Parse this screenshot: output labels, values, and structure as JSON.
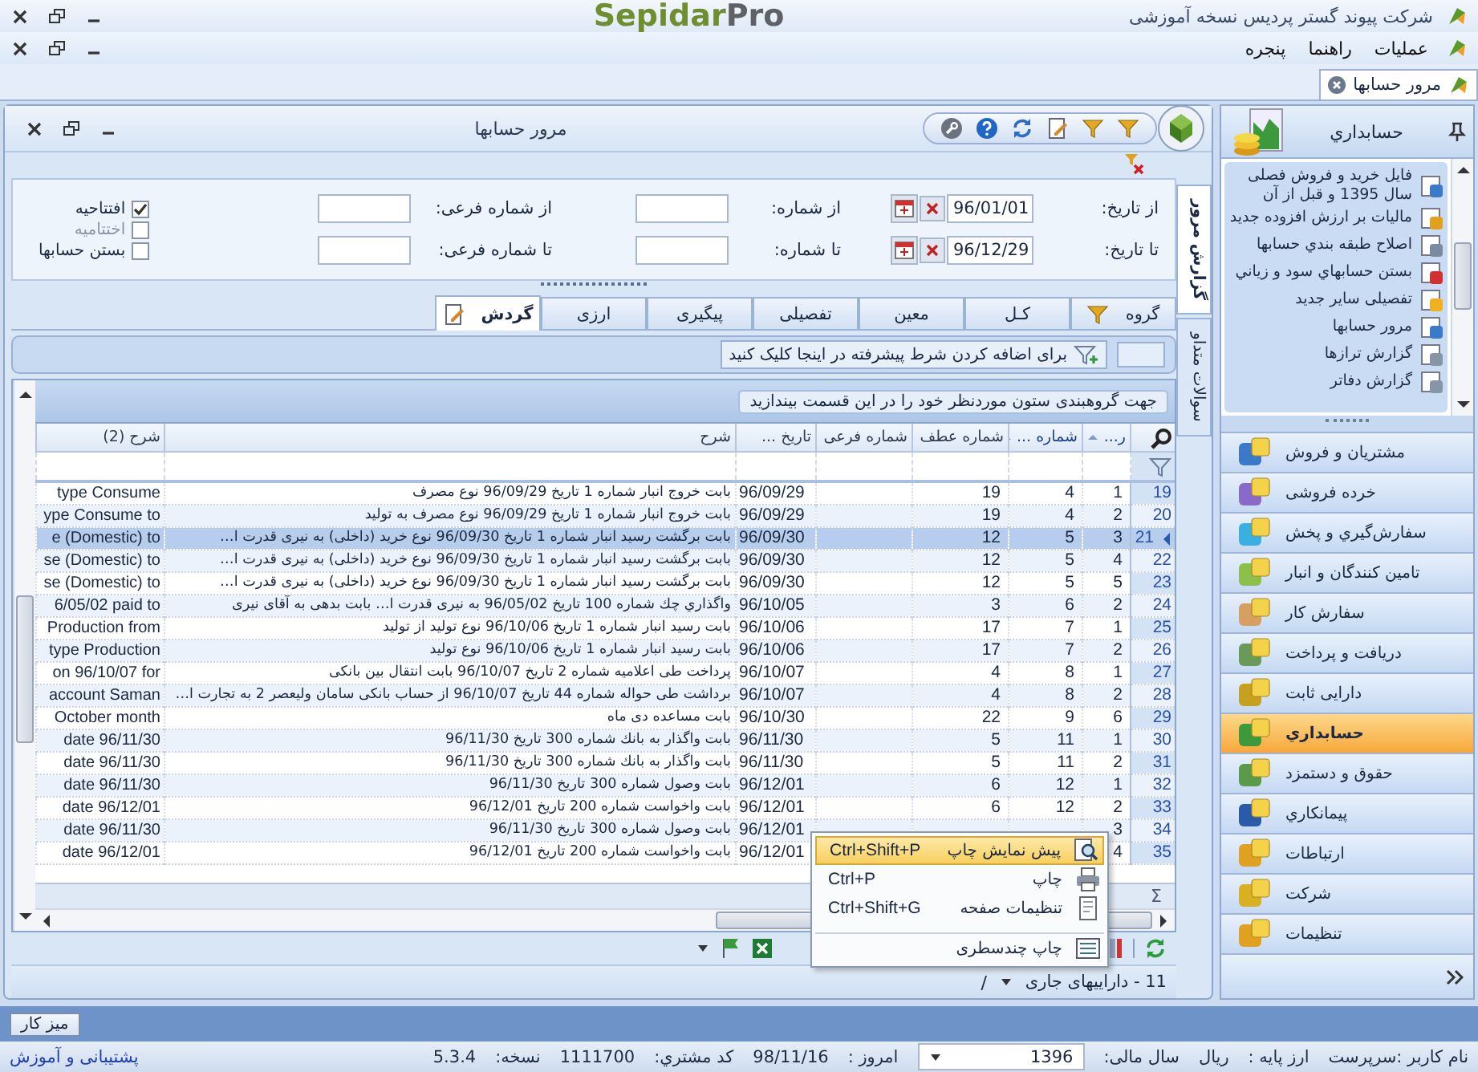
{
  "app_title": "شرکت پیوند گستر پردیس نسخه آموزشی",
  "logo": {
    "primary": "Sepidar",
    "secondary": "Pro"
  },
  "menu": [
    "عملیات",
    "راهنما",
    "پنجره"
  ],
  "document_tabs": [
    {
      "label": "مرور حسابها",
      "selected": true
    }
  ],
  "window": {
    "title": "مرور حسابها"
  },
  "side_tabs": [
    {
      "label": "گزارش مرور",
      "selected": true
    },
    {
      "label": "سوالات متداو",
      "selected": false
    }
  ],
  "filter_rows": [
    [
      {
        "kind": "date",
        "label": "از تاریخ:",
        "value": "96/01/01"
      },
      {
        "kind": "text",
        "label": "از شماره:"
      },
      {
        "kind": "text",
        "label": "از شماره فرعی:"
      }
    ],
    [
      {
        "kind": "date",
        "label": "تا تاریخ:",
        "value": "96/12/29"
      },
      {
        "kind": "text",
        "label": "تا شماره:"
      },
      {
        "kind": "text",
        "label": "تا شماره فرعی:"
      }
    ]
  ],
  "options": [
    {
      "label": "افتتاحیه",
      "checked": true,
      "disabled": false
    },
    {
      "label": "اختتامیه",
      "checked": false,
      "disabled": true
    },
    {
      "label": "بستن حسابها",
      "checked": false,
      "disabled": false
    }
  ],
  "report_tabs": [
    {
      "label": "گروه",
      "selected": false,
      "has_icon": true
    },
    {
      "label": "کـل",
      "selected": false,
      "has_icon": false
    },
    {
      "label": "معین",
      "selected": false,
      "has_icon": false
    },
    {
      "label": "تفصیلی",
      "selected": false,
      "has_icon": false
    },
    {
      "label": "پیگیری",
      "selected": false,
      "has_icon": false
    },
    {
      "label": "ارزی",
      "selected": false,
      "has_icon": false
    },
    {
      "label": "گردش",
      "selected": true,
      "has_icon": true
    }
  ],
  "advanced_filter": {
    "button": "برای اضافه کردن شرط پیشرفته در اینجا کلیک کنید"
  },
  "grid": {
    "group_hint": "جهت گروهبندی ستون موردنظر خود را در این قسمت بیندازید",
    "columns": [
      {
        "label": "ر...",
        "sorted": true
      },
      {
        "label": "شماره ...",
        "sorted": true
      },
      {
        "label": "شماره عطف",
        "sorted": false
      },
      {
        "label": "شماره فرعی",
        "sorted": false
      },
      {
        "label": "تاریخ ...",
        "sorted": false
      },
      {
        "label": "شرح",
        "sorted": false
      },
      {
        "label": "شرح (2)",
        "sorted": false
      }
    ],
    "rows": [
      {
        "row_number": "19",
        "index": "1",
        "number": "4",
        "reference": "19",
        "date": "96/09/29",
        "description": "بابت خروج انبار شماره 1 تاریخ 96/09/29 نوع مصرف",
        "description_2": "type Consume",
        "selected": false
      },
      {
        "row_number": "20",
        "index": "2",
        "number": "4",
        "reference": "19",
        "date": "96/09/29",
        "description": "بابت خروج انبار شماره 1 تاریخ 96/09/29 نوع مصرف به تولید",
        "description_2": "ype Consume to",
        "selected": false
      },
      {
        "row_number": "21",
        "index": "3",
        "number": "5",
        "reference": "12",
        "date": "96/09/30",
        "description": "بابت برگشت رسید انبار شماره 1 تاریخ 96/09/30 نوع خرید (داخلی) به نیری قدرت ا…",
        "description_2": "e (Domestic) to",
        "selected": true
      },
      {
        "row_number": "22",
        "index": "4",
        "number": "5",
        "reference": "12",
        "date": "96/09/30",
        "description": "بابت برگشت رسید انبار شماره 1 تاریخ 96/09/30 نوع خرید (داخلی) به نیری قدرت ا…",
        "description_2": "se (Domestic) to",
        "selected": false
      },
      {
        "row_number": "23",
        "index": "5",
        "number": "5",
        "reference": "12",
        "date": "96/09/30",
        "description": "بابت برگشت رسید انبار شماره 1 تاریخ 96/09/30 نوع خرید (داخلی) به نیری قدرت ا…",
        "description_2": "se (Domestic) to",
        "selected": false
      },
      {
        "row_number": "24",
        "index": "2",
        "number": "6",
        "reference": "3",
        "date": "96/10/05",
        "description": "واگذاري چك شماره 100 تاریخ 96/05/02 به نیری قدرت ا…  بابت بدهی به آقای نیری",
        "description_2": "6/05/02 paid to",
        "selected": false
      },
      {
        "row_number": "25",
        "index": "1",
        "number": "7",
        "reference": "17",
        "date": "96/10/06",
        "description": "بابت رسید انبار شماره 1 تاریخ 96/10/06 نوع تولید از تولید",
        "description_2": "Production from",
        "selected": false
      },
      {
        "row_number": "26",
        "index": "2",
        "number": "7",
        "reference": "17",
        "date": "96/10/06",
        "description": "بابت رسید انبار شماره 1 تاریخ 96/10/06 نوع تولید",
        "description_2": "type Production",
        "selected": false
      },
      {
        "row_number": "27",
        "index": "1",
        "number": "8",
        "reference": "4",
        "date": "96/10/07",
        "description": "پرداخت طی اعلامیه شماره 2 تاریخ 96/10/07 بابت انتقال بین بانکی",
        "description_2": "on 96/10/07 for",
        "selected": false
      },
      {
        "row_number": "28",
        "index": "2",
        "number": "8",
        "reference": "4",
        "date": "96/10/07",
        "description": "برداشت طی حواله شماره 44 تاریخ 96/10/07 از حساب بانکی سامان ولیعصر 2 به تجارت ا…",
        "description_2": "account Saman",
        "selected": false
      },
      {
        "row_number": "29",
        "index": "6",
        "number": "9",
        "reference": "22",
        "date": "96/10/30",
        "description": "بابت مساعده دی ماه",
        "description_2": "October month",
        "selected": false
      },
      {
        "row_number": "30",
        "index": "1",
        "number": "11",
        "reference": "5",
        "date": "96/11/30",
        "description": "بابت واگذار به بانك شماره 300 تاریخ 96/11/30",
        "description_2": "date 96/11/30",
        "selected": false
      },
      {
        "row_number": "31",
        "index": "2",
        "number": "11",
        "reference": "5",
        "date": "96/11/30",
        "description": "بابت واگذار به بانك شماره 300 تاریخ 96/11/30",
        "description_2": "date 96/11/30",
        "selected": false
      },
      {
        "row_number": "32",
        "index": "1",
        "number": "12",
        "reference": "6",
        "date": "96/12/01",
        "description": "بابت وصول شماره 300 تاریخ 96/11/30",
        "description_2": "date 96/11/30",
        "selected": false
      },
      {
        "row_number": "33",
        "index": "2",
        "number": "12",
        "reference": "6",
        "date": "96/12/01",
        "description": "بابت واخواست شماره 200 تاریخ 96/12/01",
        "description_2": "date 96/12/01",
        "selected": false
      },
      {
        "row_number": "34",
        "index": "3",
        "date": "96/12/01",
        "description": "بابت وصول شماره 300 تاریخ 96/11/30",
        "description_2": "date 96/11/30",
        "selected": false
      },
      {
        "row_number": "35",
        "index": "4",
        "date": "96/12/01",
        "description": "بابت واخواست شماره 200 تاریخ 96/12/01",
        "description_2": "date 96/12/01",
        "selected": false
      }
    ],
    "summary_symbol": "Σ"
  },
  "context_menu": [
    {
      "label": "پیش نمایش چاپ",
      "shortcut": "Ctrl+Shift+P",
      "selected": true,
      "separator_before": false
    },
    {
      "label": "چاپ",
      "shortcut": "Ctrl+P",
      "selected": false,
      "separator_before": false
    },
    {
      "label": "تنظیمات صفحه",
      "shortcut": "Ctrl+Shift+G",
      "selected": false,
      "separator_before": false
    },
    {
      "label": "چاپ چندسطری",
      "selected": false,
      "separator_before": true
    }
  ],
  "footer": {
    "account": "11 - داراییهای جاری",
    "separator": "/"
  },
  "sidebar": {
    "title": "حسابداري",
    "items": [
      "فایل خرید و فروش فصلی سال 1395 و قبل از آن",
      "مالیات بر ارزش افزوده جدید",
      "اصلاح طبقه بندي حسابها",
      "بستن حسابهاي سود و زياني",
      "تفصیلی سایر جدید",
      "مرور حسابها",
      "گزارش ترازها",
      "گزارش دفاتر"
    ],
    "modules": [
      {
        "label": "مشتریان و فروش",
        "selected": false
      },
      {
        "label": "خرده فروشی",
        "selected": false
      },
      {
        "label": "سفارش‌گیري و پخش",
        "selected": false
      },
      {
        "label": "تامین کنندگان و انبار",
        "selected": false
      },
      {
        "label": "سفارش کار",
        "selected": false
      },
      {
        "label": "دریافت و پرداخت",
        "selected": false
      },
      {
        "label": "دارایی ثابت",
        "selected": false
      },
      {
        "label": "حسابداري",
        "selected": true
      },
      {
        "label": "حقوق و دستمزد",
        "selected": false
      },
      {
        "label": "پیمانکاري",
        "selected": false
      },
      {
        "label": "ارتباطات",
        "selected": false
      },
      {
        "label": "شرکت",
        "selected": false
      },
      {
        "label": "تنظیمات",
        "selected": false
      }
    ]
  },
  "taskbar": {
    "button": "میز کار"
  },
  "status_bar": {
    "user": "نام کاربر :سرپرست",
    "base_currency_label": "ارز پایه :",
    "base_currency": "ریال",
    "fiscal_year_label": "سال مالی:",
    "fiscal_year": "1396",
    "today_label": "امروز :",
    "today": "98/11/16",
    "customer_code_label": "کد مشتري:",
    "customer_code": "1111700",
    "version_label": "نسخه:",
    "version": "5.3.4",
    "support_link": "پشتیبانی و آموزش"
  }
}
